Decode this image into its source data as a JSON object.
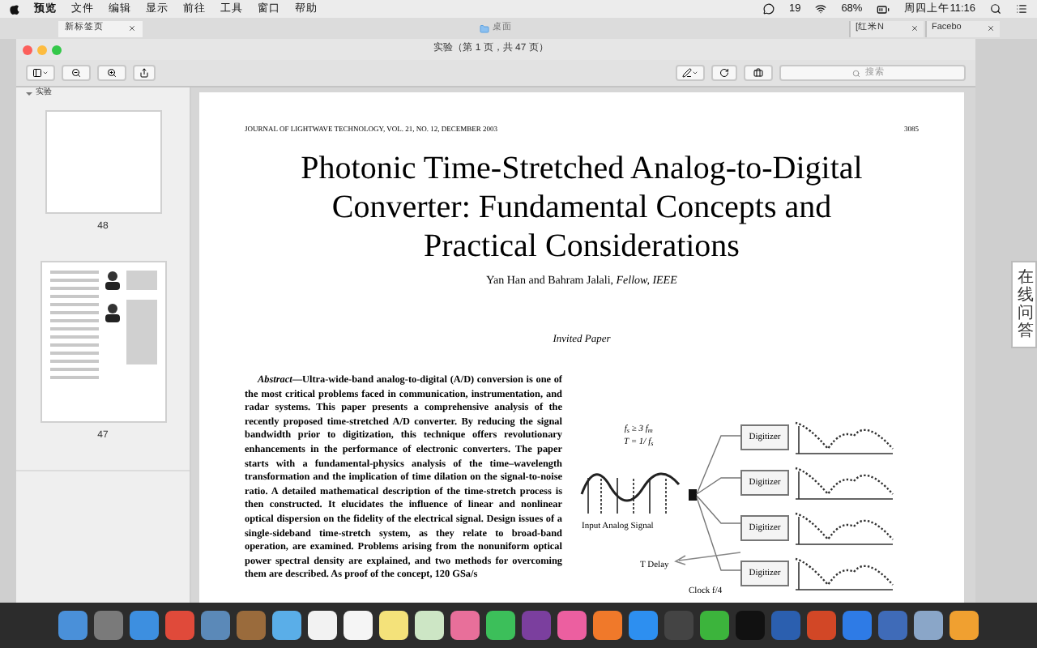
{
  "menu_bar": {
    "app_menus": [
      "预览",
      "文件",
      "编辑",
      "显示",
      "前往",
      "工具",
      "窗口",
      "帮助"
    ],
    "wechat_count": "19",
    "battery": "68%",
    "clock": "周四上午11:16"
  },
  "background_window": {
    "left_tab": {
      "label": "新标签页",
      "selected": true
    },
    "title": "桌面",
    "right_tabs": [
      {
        "label": "[红米N",
        "selected": false
      },
      {
        "label": "Facebo",
        "selected": false
      }
    ]
  },
  "window": {
    "title": "实验（第 1 页，共 47 页）",
    "search": {
      "placeholder": "搜索"
    }
  },
  "sidebar": {
    "title": "实验",
    "expanded": true,
    "pages": [
      {
        "label": "48",
        "kind": "blank"
      },
      {
        "label": "47",
        "kind": "photos"
      }
    ]
  },
  "document": {
    "running_head": "JOURNAL OF LIGHTWAVE TECHNOLOGY, VOL. 21, NO. 12, DECEMBER 2003",
    "page_number": "3085",
    "title": [
      "Photonic Time-Stretched Analog-to-Digital",
      "Converter: Fundamental Concepts and",
      "Practical Considerations"
    ],
    "authors": "Yan Han and Bahram Jalali, *Fellow, IEEE*",
    "note": "Invited Paper",
    "abstract": "*Abstract*—Ultra-wide-band analog-to-digital (A/D) conversion is one of the most critical problems faced in communication, instrumentation, and radar systems. This paper presents a comprehensive analysis of the recently proposed time-stretched A/D converter. By reducing the signal bandwidth prior to digitization, this technique offers revolutionary enhancements in the performance of electronic converters. The paper starts with a fundamental-physics analysis of the time–wavelength transformation and the implication of time dilation on the signal-to-noise ratio. A detailed mathematical description of the time-stretch process is then constructed. It elucidates the influence of linear and nonlinear optical dispersion on the fidelity of the electrical signal. Design issues of a single-sideband time-stretch system, as they relate to broad-band operation, are examined. Problems arising from the nonuniform optical power spectral density are explained, and two methods for overcoming them are described. As proof of the concept, 120 GSa/s",
    "figure": {
      "formula": [
        "f$_{s}$ ≥ 3 f$_{m}$",
        "T = 1/ f$_{s}$"
      ],
      "input_label": "Input Analog Signal",
      "delay_label": "T Delay",
      "digitizers": [
        "Digitizer",
        "Digitizer",
        "Digitizer",
        "Digitizer"
      ],
      "clock_label": "Clock f/4"
    }
  },
  "side_tab": {
    "label": "在线问答"
  }
}
